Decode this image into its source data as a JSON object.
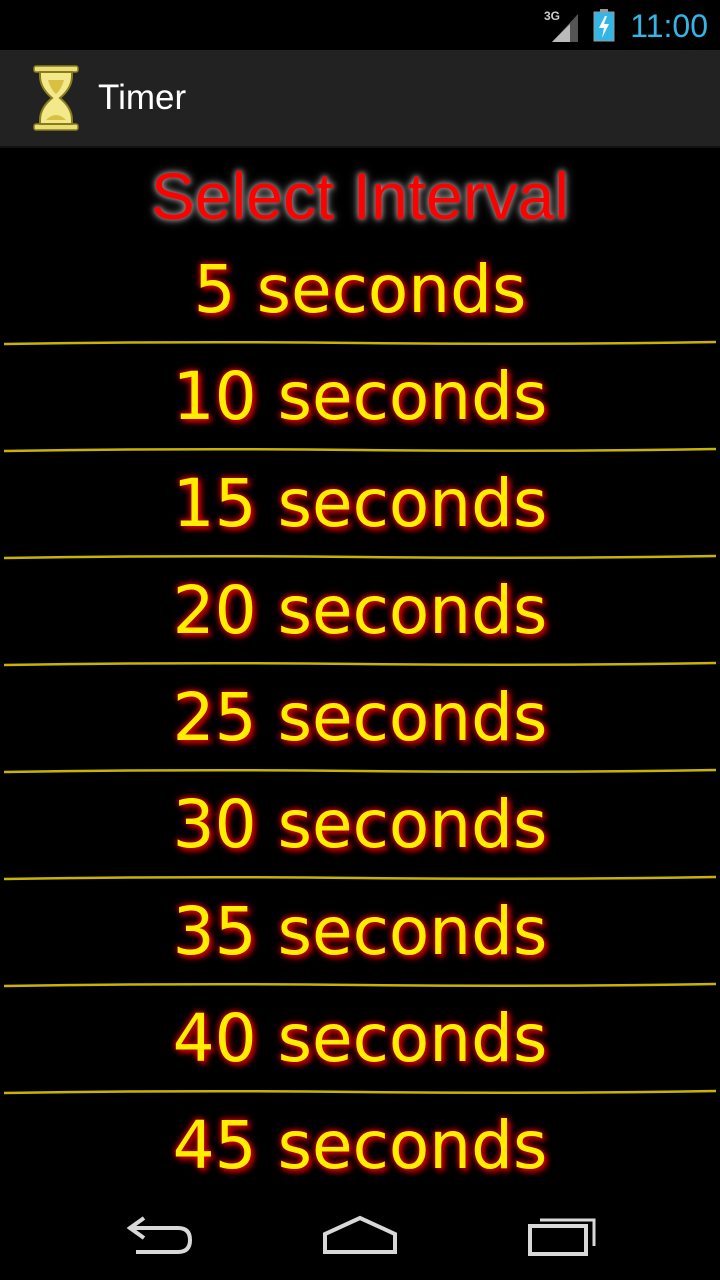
{
  "status_bar": {
    "network": "3G",
    "time": "11:00",
    "signal_icon": "signal-icon",
    "battery_icon": "battery-charging-icon"
  },
  "action_bar": {
    "title": "Timer",
    "icon": "hourglass-icon"
  },
  "main": {
    "heading": "Select Interval",
    "items": [
      {
        "label": "5 seconds"
      },
      {
        "label": "10 seconds"
      },
      {
        "label": "15 seconds"
      },
      {
        "label": "20 seconds"
      },
      {
        "label": "25 seconds"
      },
      {
        "label": "30 seconds"
      },
      {
        "label": "35 seconds"
      },
      {
        "label": "40 seconds"
      },
      {
        "label": "45 seconds"
      }
    ]
  },
  "nav_bar": {
    "buttons": [
      "back-icon",
      "home-icon",
      "recent-apps-icon"
    ]
  },
  "colors": {
    "heading": "#ff0000",
    "item_text": "#ffee00",
    "item_shadow": "#d00000",
    "divider": "#c8b400",
    "clock": "#33b5e5"
  }
}
